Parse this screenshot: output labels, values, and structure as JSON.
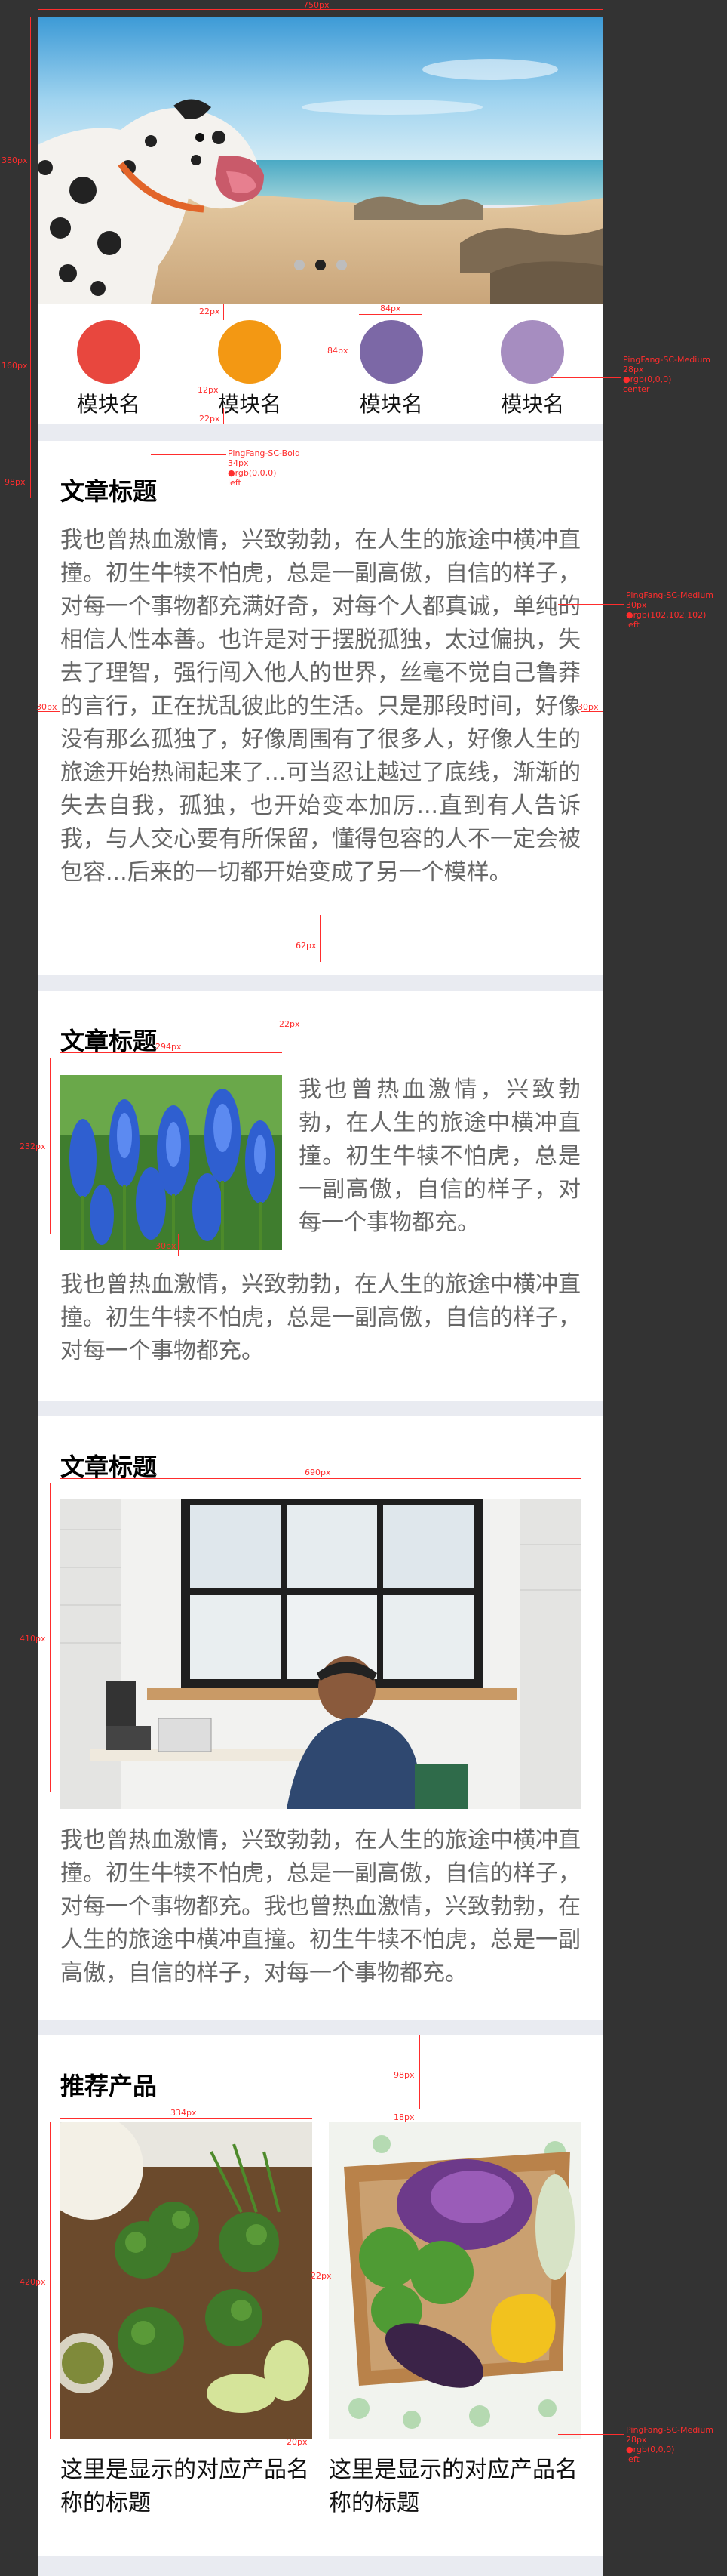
{
  "hero": {
    "dot_count": 3,
    "active_dot": 1
  },
  "modules": [
    {
      "label": "模块名",
      "color": "#e8473e"
    },
    {
      "label": "模块名",
      "color": "#f39813"
    },
    {
      "label": "模块名",
      "color": "#7c68a6"
    },
    {
      "label": "模块名",
      "color": "#a68dc0"
    }
  ],
  "article1": {
    "title": "文章标题",
    "body": "我也曾热血激情，兴致勃勃，在人生的旅途中横冲直撞。初生牛犊不怕虎，总是一副高傲，自信的样子，对每一个事物都充满好奇，对每个人都真诚，单纯的相信人性本善。也许是对于摆脱孤独，太过偏执，失去了理智，强行闯入他人的世界，丝毫不觉自己鲁莽的言行，正在扰乱彼此的生活。只是那段时间，好像没有那么孤独了，好像周围有了很多人，好像人生的旅途开始热闹起来了...可当忍让越过了底线，渐渐的失去自我，孤独，也开始变本加厉...直到有人告诉我，与人交心要有所保留，懂得包容的人不一定会被包容...后来的一切都开始变成了另一个模样。"
  },
  "article2": {
    "title": "文章标题",
    "side_text": "我也曾热血激情，兴致勃勃，在人生的旅途中横冲直撞。初生牛犊不怕虎，总是一副高傲，自信的样子，对每一个事物都充。",
    "body": "我也曾热血激情，兴致勃勃，在人生的旅途中横冲直撞。初生牛犊不怕虎，总是一副高傲，自信的样子，对每一个事物都充。"
  },
  "article3": {
    "title": "文章标题",
    "body": "我也曾热血激情，兴致勃勃，在人生的旅途中横冲直撞。初生牛犊不怕虎，总是一副高傲，自信的样子，对每一个事物都充。我也曾热血激情，兴致勃勃，在人生的旅途中横冲直撞。初生牛犊不怕虎，总是一副高傲，自信的样子，对每一个事物都充。"
  },
  "products": {
    "title": "推荐产品",
    "items": [
      {
        "title": "这里是显示的对应产品名称的标题"
      },
      {
        "title": "这里是显示的对应产品名称的标题"
      }
    ]
  },
  "annotations": {
    "w750": "750px",
    "h380": "380px",
    "h160": "160px",
    "gap22a": "22px",
    "gap12": "12px",
    "gap22b": "22px",
    "w84": "84px",
    "h84": "84px",
    "module_font": [
      "PingFang-SC-Medium",
      "28px",
      "●rgb(0,0,0)",
      "center"
    ],
    "h98a": "98px",
    "title_font": [
      "PingFang-SC-Bold",
      "34px",
      "●rgb(0,0,0)",
      "left"
    ],
    "body_font": [
      "PingFang-SC-Medium",
      "30px",
      "●rgb(102,102,102)",
      "left"
    ],
    "m30l": "30px",
    "m30r": "30px",
    "h62": "62px",
    "w294": "294px",
    "g22": "22px",
    "h232": "232px",
    "g30": "30px",
    "w690": "690px",
    "h410": "410px",
    "h98b": "98px",
    "g18": "18px",
    "w334": "334px",
    "h420": "420px",
    "g22c": "22px",
    "g20": "20px",
    "product_font": [
      "PingFang-SC-Medium",
      "28px",
      "●rgb(0,0,0)",
      "left"
    ]
  }
}
